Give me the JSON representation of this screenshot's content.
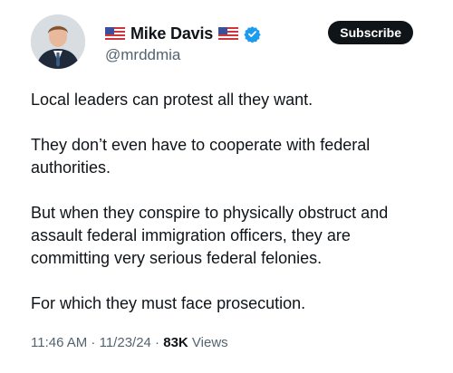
{
  "author": {
    "display_name": "Mike Davis",
    "handle": "@mrddmia",
    "verified": true,
    "flag_icon": "us-flag-icon"
  },
  "subscribe_label": "Subscribe",
  "tweet": {
    "paragraphs": [
      "Local leaders can protest all they want.",
      "They don’t even have to cooperate with federal authorities.",
      "But when they conspire to physically obstruct and assault federal immigration officers, they are committing very serious federal felonies.",
      "For which they must face prosecution."
    ]
  },
  "meta": {
    "time": "11:46 AM",
    "sep1": " · ",
    "date": "11/23/24",
    "sep2": " · ",
    "views_count": "83K",
    "views_label": " Views"
  },
  "colors": {
    "text": "#0f1419",
    "secondary": "#536471",
    "verified_blue": "#1d9bf0",
    "button_bg": "#0f1419"
  }
}
